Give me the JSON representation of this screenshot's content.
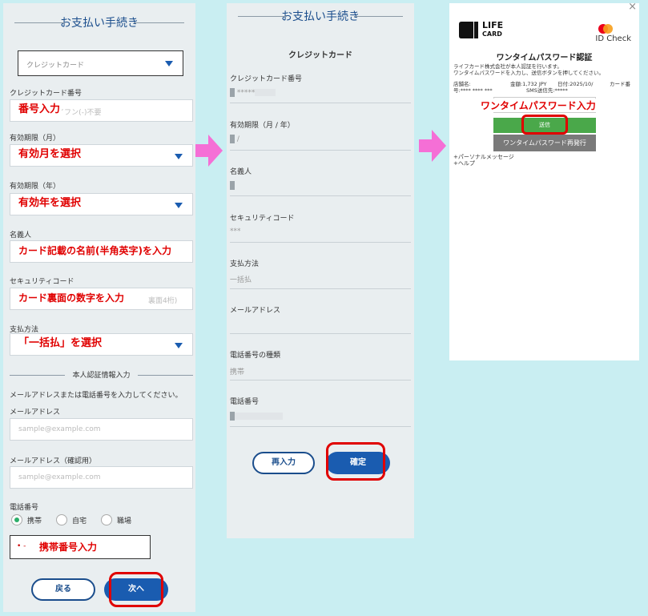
{
  "form": {
    "title": "お支払い手続き",
    "card_select": "クレジットカード",
    "card_number_label": "クレジットカード番号",
    "card_number_placeholder": "イフン(-)不要",
    "card_number_annotation": "番号入力",
    "exp_month_label": "有効期限（月）",
    "exp_month_annotation": "有効月を選択",
    "exp_year_label": "有効期限（年）",
    "exp_year_annotation": "有効年を選択",
    "name_label": "名義人",
    "name_annotation": "カード記載の名前(半角英字)を入力",
    "security_label": "セキュリティコード",
    "security_placeholder": "裏面4桁)",
    "security_annotation": "カード裏面の数字を入力",
    "payment_label": "支払方法",
    "payment_annotation": "「一括払」を選択",
    "auth_divider": "本人認証情報入力",
    "auth_instruction": "メールアドレスまたは電話番号を入力してください。",
    "email_label": "メールアドレス",
    "email_placeholder": "sample@example.com",
    "email_confirm_label": "メールアドレス（確認用）",
    "email_confirm_placeholder": "sample@example.com",
    "phone_label": "電話番号",
    "phone_types": [
      "携帯",
      "自宅",
      "職場"
    ],
    "phone_prefix": "• -",
    "phone_annotation": "携帯番号入力",
    "back_button": "戻る",
    "next_button": "次へ"
  },
  "confirm": {
    "title": "お支払い手続き",
    "heading": "クレジットカード",
    "card_number_label": "クレジットカード番号",
    "card_number_value": "*****",
    "expiry_label": "有効期限（月 / 年）",
    "expiry_value": "/",
    "name_label": "名義人",
    "security_label": "セキュリティコード",
    "security_value": "***",
    "payment_label": "支払方法",
    "payment_value": "一括払",
    "email_label": "メールアドレス",
    "phone_type_label": "電話番号の種類",
    "phone_type_value": "携帯",
    "phone_label": "電話番号",
    "reenter_button": "再入力",
    "confirm_button": "確定"
  },
  "otp": {
    "close": "×",
    "brand_line1": "LIFE",
    "brand_line2": "CARD",
    "id_check": "ID Check",
    "title": "ワンタイムパスワード認証",
    "desc_line1": "ライフカード株式会社が本人認証を行います。",
    "desc_line2": "ワンタイムパスワードを入力し、送信ボタンを押してください。",
    "store_label": "店舗名:",
    "amount": "金額:1,732 JPY",
    "date": "日付:2025/10/",
    "card_label": "カード番",
    "card_num_label": "号:**** **** ***",
    "sms_label": "SMS送信先:*****",
    "input_annotation": "ワンタイムパスワード入力",
    "send_button": "送信",
    "resend_button": "ワンタイムパスワード再発行",
    "link_personal": "+パーソナルメッセージ",
    "link_help": "+ヘルプ",
    "colors": {
      "send": "#4aa84a",
      "resend": "#7a7a7a",
      "accent": "#e00000"
    }
  }
}
